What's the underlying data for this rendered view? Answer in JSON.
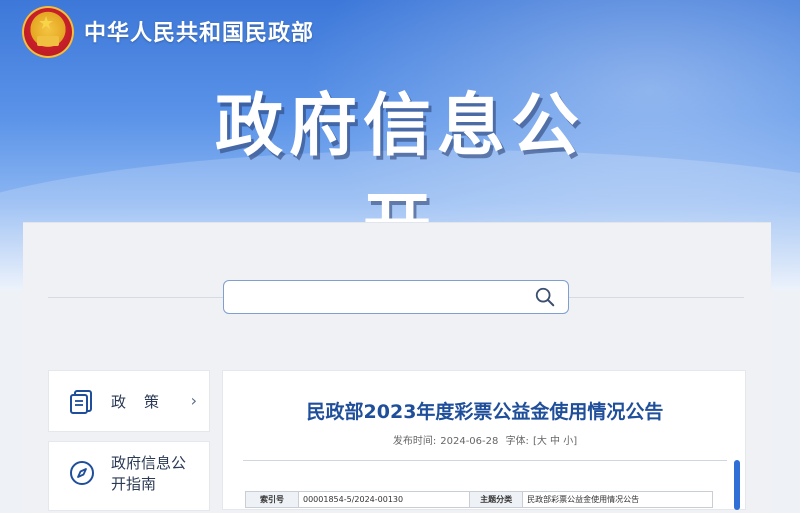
{
  "header": {
    "ministry_name": "中华人民共和国民政部",
    "section_title": "政府信息公开"
  },
  "search": {
    "placeholder": "",
    "value": ""
  },
  "sidebar": {
    "items": [
      {
        "label": "政策",
        "icon": "document-stack-icon"
      },
      {
        "label": "政府信息公开指南",
        "icon": "compass-icon"
      }
    ]
  },
  "article": {
    "title": "民政部2023年度彩票公益金使用情况公告",
    "publish_label": "发布时间:",
    "publish_date": "2024-06-28",
    "font_label": "字体:",
    "font_sizes": "[大 中 小]",
    "info": {
      "index_label": "索引号",
      "index_value": "00001854-5/2024-00130",
      "topic_label": "主题分类",
      "topic_value": "民政部彩票公益金使用情况公告"
    }
  },
  "colors": {
    "brand_blue": "#1f4e9a",
    "accent_blue": "#2f6fd6"
  }
}
